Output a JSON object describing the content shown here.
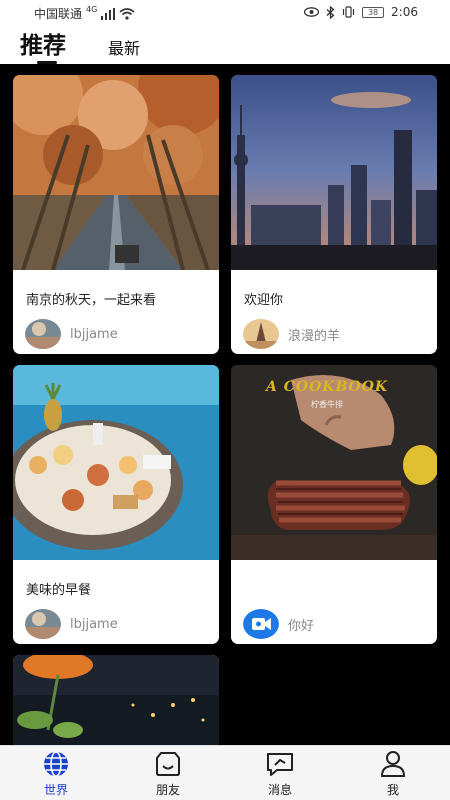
{
  "status_bar": {
    "carrier": "中国联通",
    "network": "4G",
    "battery": "38",
    "time": "2:06"
  },
  "tabs": {
    "recommended": "推荐",
    "latest": "最新"
  },
  "cards": [
    {
      "title": "南京的秋天，一起来看",
      "author": "lbjjame"
    },
    {
      "title": "欢迎你",
      "author": "浪漫的羊"
    },
    {
      "title": "美味的早餐",
      "author": "lbjjame"
    },
    {
      "title": "",
      "author": "你好",
      "image_text": "A COOKBOOK",
      "image_subtext": "柠香牛排"
    }
  ],
  "nav": {
    "world": "世界",
    "friends": "朋友",
    "messages": "消息",
    "me": "我"
  },
  "colors": {
    "accent": "#1a40c8",
    "feed_bg": "#000000"
  }
}
